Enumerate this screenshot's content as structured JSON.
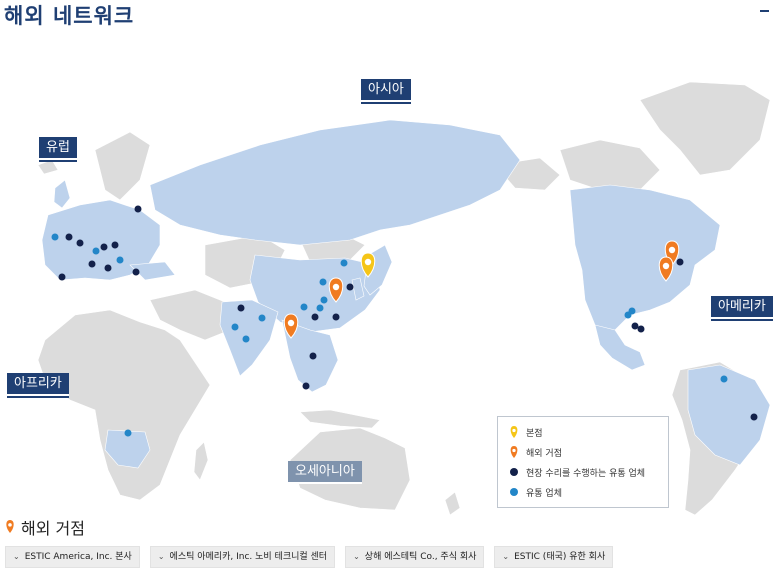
{
  "page": {
    "title": "해외 네트워크"
  },
  "regions": {
    "asia": "아시아",
    "europe": "유럽",
    "africa": "아프리카",
    "oceania": "오세아니아",
    "america": "아메리카"
  },
  "legend": {
    "items": [
      {
        "label": "본점",
        "symbol": "pin",
        "color": "#f5c518"
      },
      {
        "label": "해외 거점",
        "symbol": "pin",
        "color": "#f07b21"
      },
      {
        "label": "현장 수리를 수행하는 유통 업체",
        "symbol": "dot",
        "color": "#13214a"
      },
      {
        "label": "유통 업체",
        "symbol": "dot",
        "color": "#2386c8"
      }
    ]
  },
  "colors": {
    "land_network": "#bdd2ec",
    "land_other": "#dcdcdc",
    "pin_headquarters": "#f5c518",
    "pin_overseas": "#f07b21",
    "dot_service": "#13214a",
    "dot_distributor": "#2386c8",
    "title": "#1f3f73"
  },
  "section": {
    "title": "해외 거점"
  },
  "locations": [
    {
      "label": "ESTIC America, Inc. 본사"
    },
    {
      "label": "에스틱 아메리카, Inc. 노비 테크니컬 센터"
    },
    {
      "label": "상해 에스테틱 Co., 주식 회사"
    },
    {
      "label": "ESTIC (태국) 유한 회사"
    }
  ]
}
